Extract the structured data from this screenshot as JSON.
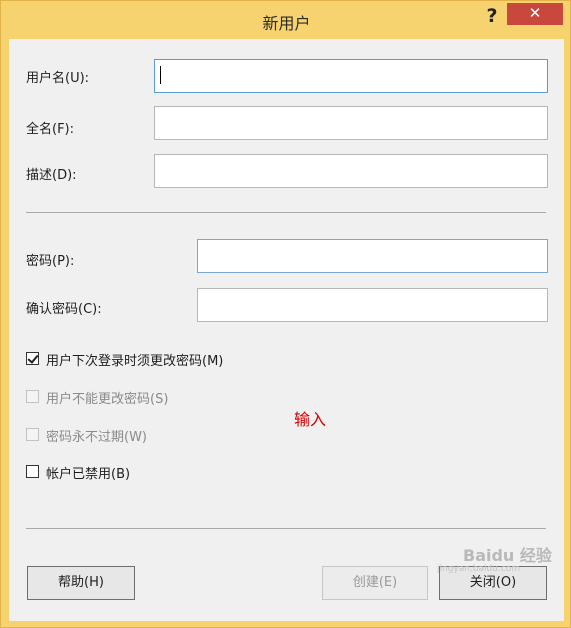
{
  "window": {
    "title": "新用户",
    "help_glyph": "?",
    "close_glyph": "✕"
  },
  "fields": {
    "username": {
      "label": "用户名(U):",
      "value": ""
    },
    "fullname": {
      "label": "全名(F):",
      "value": ""
    },
    "description": {
      "label": "描述(D):",
      "value": ""
    },
    "password": {
      "label": "密码(P):",
      "value": ""
    },
    "confirm_password": {
      "label": "确认密码(C):",
      "value": ""
    }
  },
  "options": [
    {
      "label": "用户下次登录时须更改密码(M)",
      "checked": true,
      "enabled": true
    },
    {
      "label": "用户不能更改密码(S)",
      "checked": false,
      "enabled": false
    },
    {
      "label": "密码永不过期(W)",
      "checked": false,
      "enabled": false
    },
    {
      "label": "帐户已禁用(B)",
      "checked": false,
      "enabled": true
    }
  ],
  "annotation": "输入",
  "buttons": {
    "help": "帮助(H)",
    "create": "创建(E)",
    "close": "关闭(O)"
  },
  "watermark": {
    "text": "Baidu 经验",
    "url": "jingyan.baidu.com"
  },
  "colors": {
    "title_bar": "#f6d36e",
    "close_button": "#c8483e",
    "annotation": "#d00000",
    "focus_border": "#5b9bd5"
  }
}
